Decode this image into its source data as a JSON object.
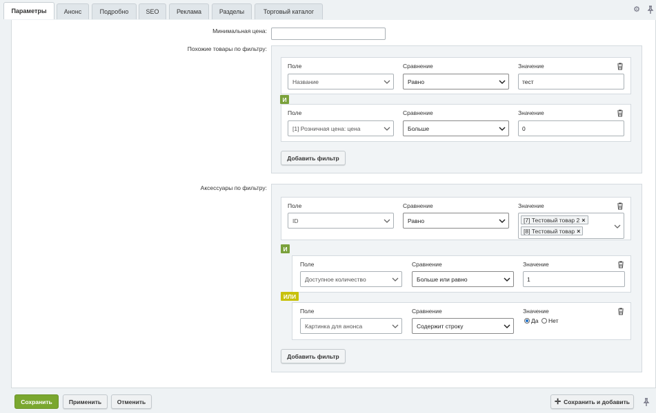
{
  "tabs": [
    "Параметры",
    "Анонс",
    "Подробно",
    "SEO",
    "Реклама",
    "Разделы",
    "Торговый каталог"
  ],
  "form": {
    "min_price_label": "Минимальная цена:",
    "min_price_value": "",
    "similar_label": "Похожие товары по фильтру:",
    "accessories_label": "Аксессуары по фильтру:"
  },
  "filter_headers": {
    "field": "Поле",
    "compare": "Сравнение",
    "value": "Значение"
  },
  "connectors": {
    "and": "И",
    "or": "ИЛИ"
  },
  "similar_filters": [
    {
      "field": "Название",
      "compare": "Равно",
      "value": "тест"
    },
    {
      "field": "[1] Розничная цена: цена",
      "compare": "Больше",
      "value": "0"
    }
  ],
  "accessory_filters": {
    "first": {
      "field": "ID",
      "compare": "Равно",
      "chips": [
        "[7] Тестовый товар 2",
        "[8] Тестовый товар"
      ]
    },
    "second": {
      "field": "Доступное количество",
      "compare": "Больше или равно",
      "value": "1"
    },
    "third": {
      "field": "Картинка для анонса",
      "compare": "Содержит строку",
      "radio_yes": "Да",
      "radio_no": "Нет",
      "selected": "Да"
    }
  },
  "add_filter_label": "Добавить фильтр",
  "footer": {
    "save": "Сохранить",
    "apply": "Применить",
    "cancel": "Отменить",
    "save_add": "Сохранить и добавить"
  },
  "colors": {
    "accent_green": "#7aa72f",
    "and_badge": "#7aa13b",
    "or_badge": "#c8c10b"
  }
}
